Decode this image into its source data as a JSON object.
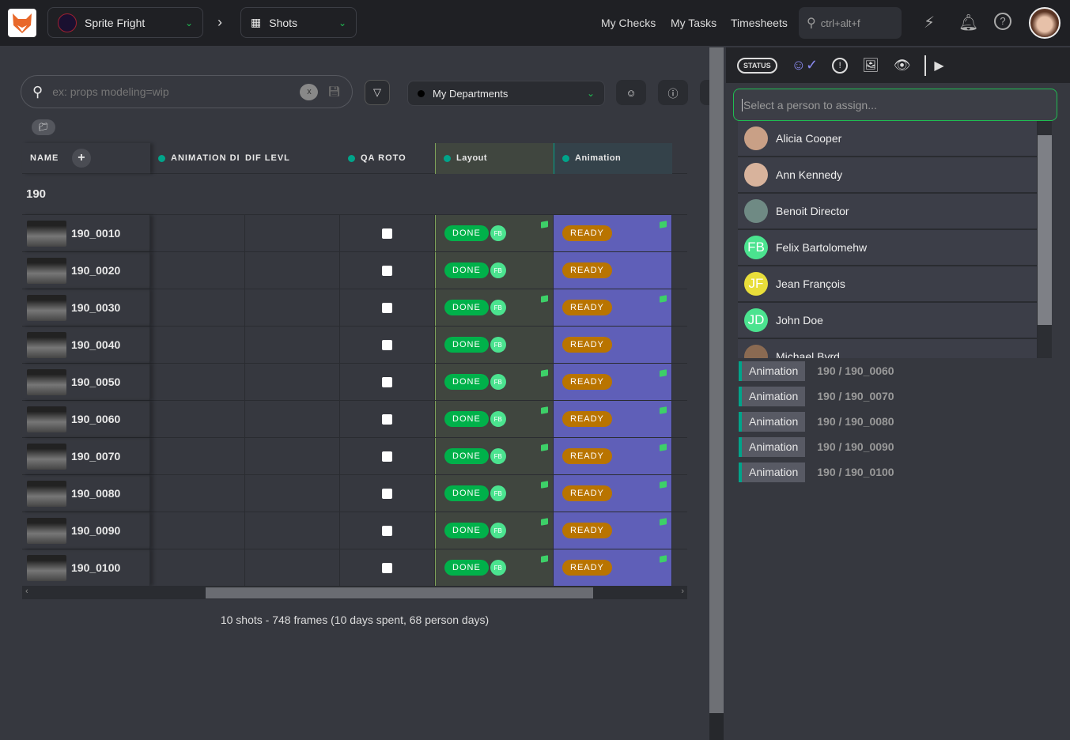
{
  "topbar": {
    "project": "Sprite Fright",
    "section": "Shots",
    "nav": [
      "My Checks",
      "My Tasks",
      "Timesheets"
    ],
    "search_placeholder": "ctrl+alt+f"
  },
  "filters": {
    "search_placeholder": "ex: props modeling=wip",
    "clear_label": "x",
    "department": "My Departments"
  },
  "table": {
    "headers": {
      "name": "NAME",
      "animation_difficulty": "ANIMATION DI",
      "difficulty_level": "DIF LEVL",
      "qa_roto": "QA ROTO",
      "layout": "Layout",
      "animation": "Animation"
    },
    "group": "190",
    "rows": [
      {
        "name": "190_0010",
        "layout": "DONE",
        "layout_assignee": "FB",
        "animation": "READY",
        "layout_cube": true,
        "animation_cube": true
      },
      {
        "name": "190_0020",
        "layout": "DONE",
        "layout_assignee": "FB",
        "animation": "READY",
        "layout_cube": false,
        "animation_cube": false
      },
      {
        "name": "190_0030",
        "layout": "DONE",
        "layout_assignee": "FB",
        "animation": "READY",
        "layout_cube": true,
        "animation_cube": true
      },
      {
        "name": "190_0040",
        "layout": "DONE",
        "layout_assignee": "FB",
        "animation": "READY",
        "layout_cube": false,
        "animation_cube": false
      },
      {
        "name": "190_0050",
        "layout": "DONE",
        "layout_assignee": "FB",
        "animation": "READY",
        "layout_cube": true,
        "animation_cube": true
      },
      {
        "name": "190_0060",
        "layout": "DONE",
        "layout_assignee": "FB",
        "animation": "READY",
        "layout_cube": true,
        "animation_cube": true
      },
      {
        "name": "190_0070",
        "layout": "DONE",
        "layout_assignee": "FB",
        "animation": "READY",
        "layout_cube": true,
        "animation_cube": true
      },
      {
        "name": "190_0080",
        "layout": "DONE",
        "layout_assignee": "FB",
        "animation": "READY",
        "layout_cube": true,
        "animation_cube": true
      },
      {
        "name": "190_0090",
        "layout": "DONE",
        "layout_assignee": "FB",
        "animation": "READY",
        "layout_cube": true,
        "animation_cube": true
      },
      {
        "name": "190_0100",
        "layout": "DONE",
        "layout_assignee": "FB",
        "animation": "READY",
        "layout_cube": true,
        "animation_cube": true
      }
    ],
    "summary": "10 shots - 748 frames (10 days spent, 68 person days)"
  },
  "panel": {
    "status_label": "STATUS",
    "assign_placeholder": "Select a person to assign...",
    "people": [
      {
        "name": "Alicia Cooper",
        "initials": "",
        "color": "#c9a086"
      },
      {
        "name": "Ann Kennedy",
        "initials": "",
        "color": "#d8b39c"
      },
      {
        "name": "Benoit Director",
        "initials": "",
        "color": "#6f8a84"
      },
      {
        "name": "Felix Bartolomehw",
        "initials": "FB",
        "color": "#4be38f"
      },
      {
        "name": "Jean François",
        "initials": "JF",
        "color": "#e8de3a"
      },
      {
        "name": "John Doe",
        "initials": "JD",
        "color": "#4be38f"
      },
      {
        "name": "Michael Byrd",
        "initials": "",
        "color": "#8a6a52"
      }
    ],
    "tasks": [
      {
        "type": "Animation",
        "path": "190 / 190_0060"
      },
      {
        "type": "Animation",
        "path": "190 / 190_0070"
      },
      {
        "type": "Animation",
        "path": "190 / 190_0080"
      },
      {
        "type": "Animation",
        "path": "190 / 190_0090"
      },
      {
        "type": "Animation",
        "path": "190 / 190_0100"
      }
    ]
  },
  "colors": {
    "done": "#00b14a",
    "ready": "#b97400",
    "animation_column": "#5f5fb8",
    "accent": "#1fbd52"
  }
}
